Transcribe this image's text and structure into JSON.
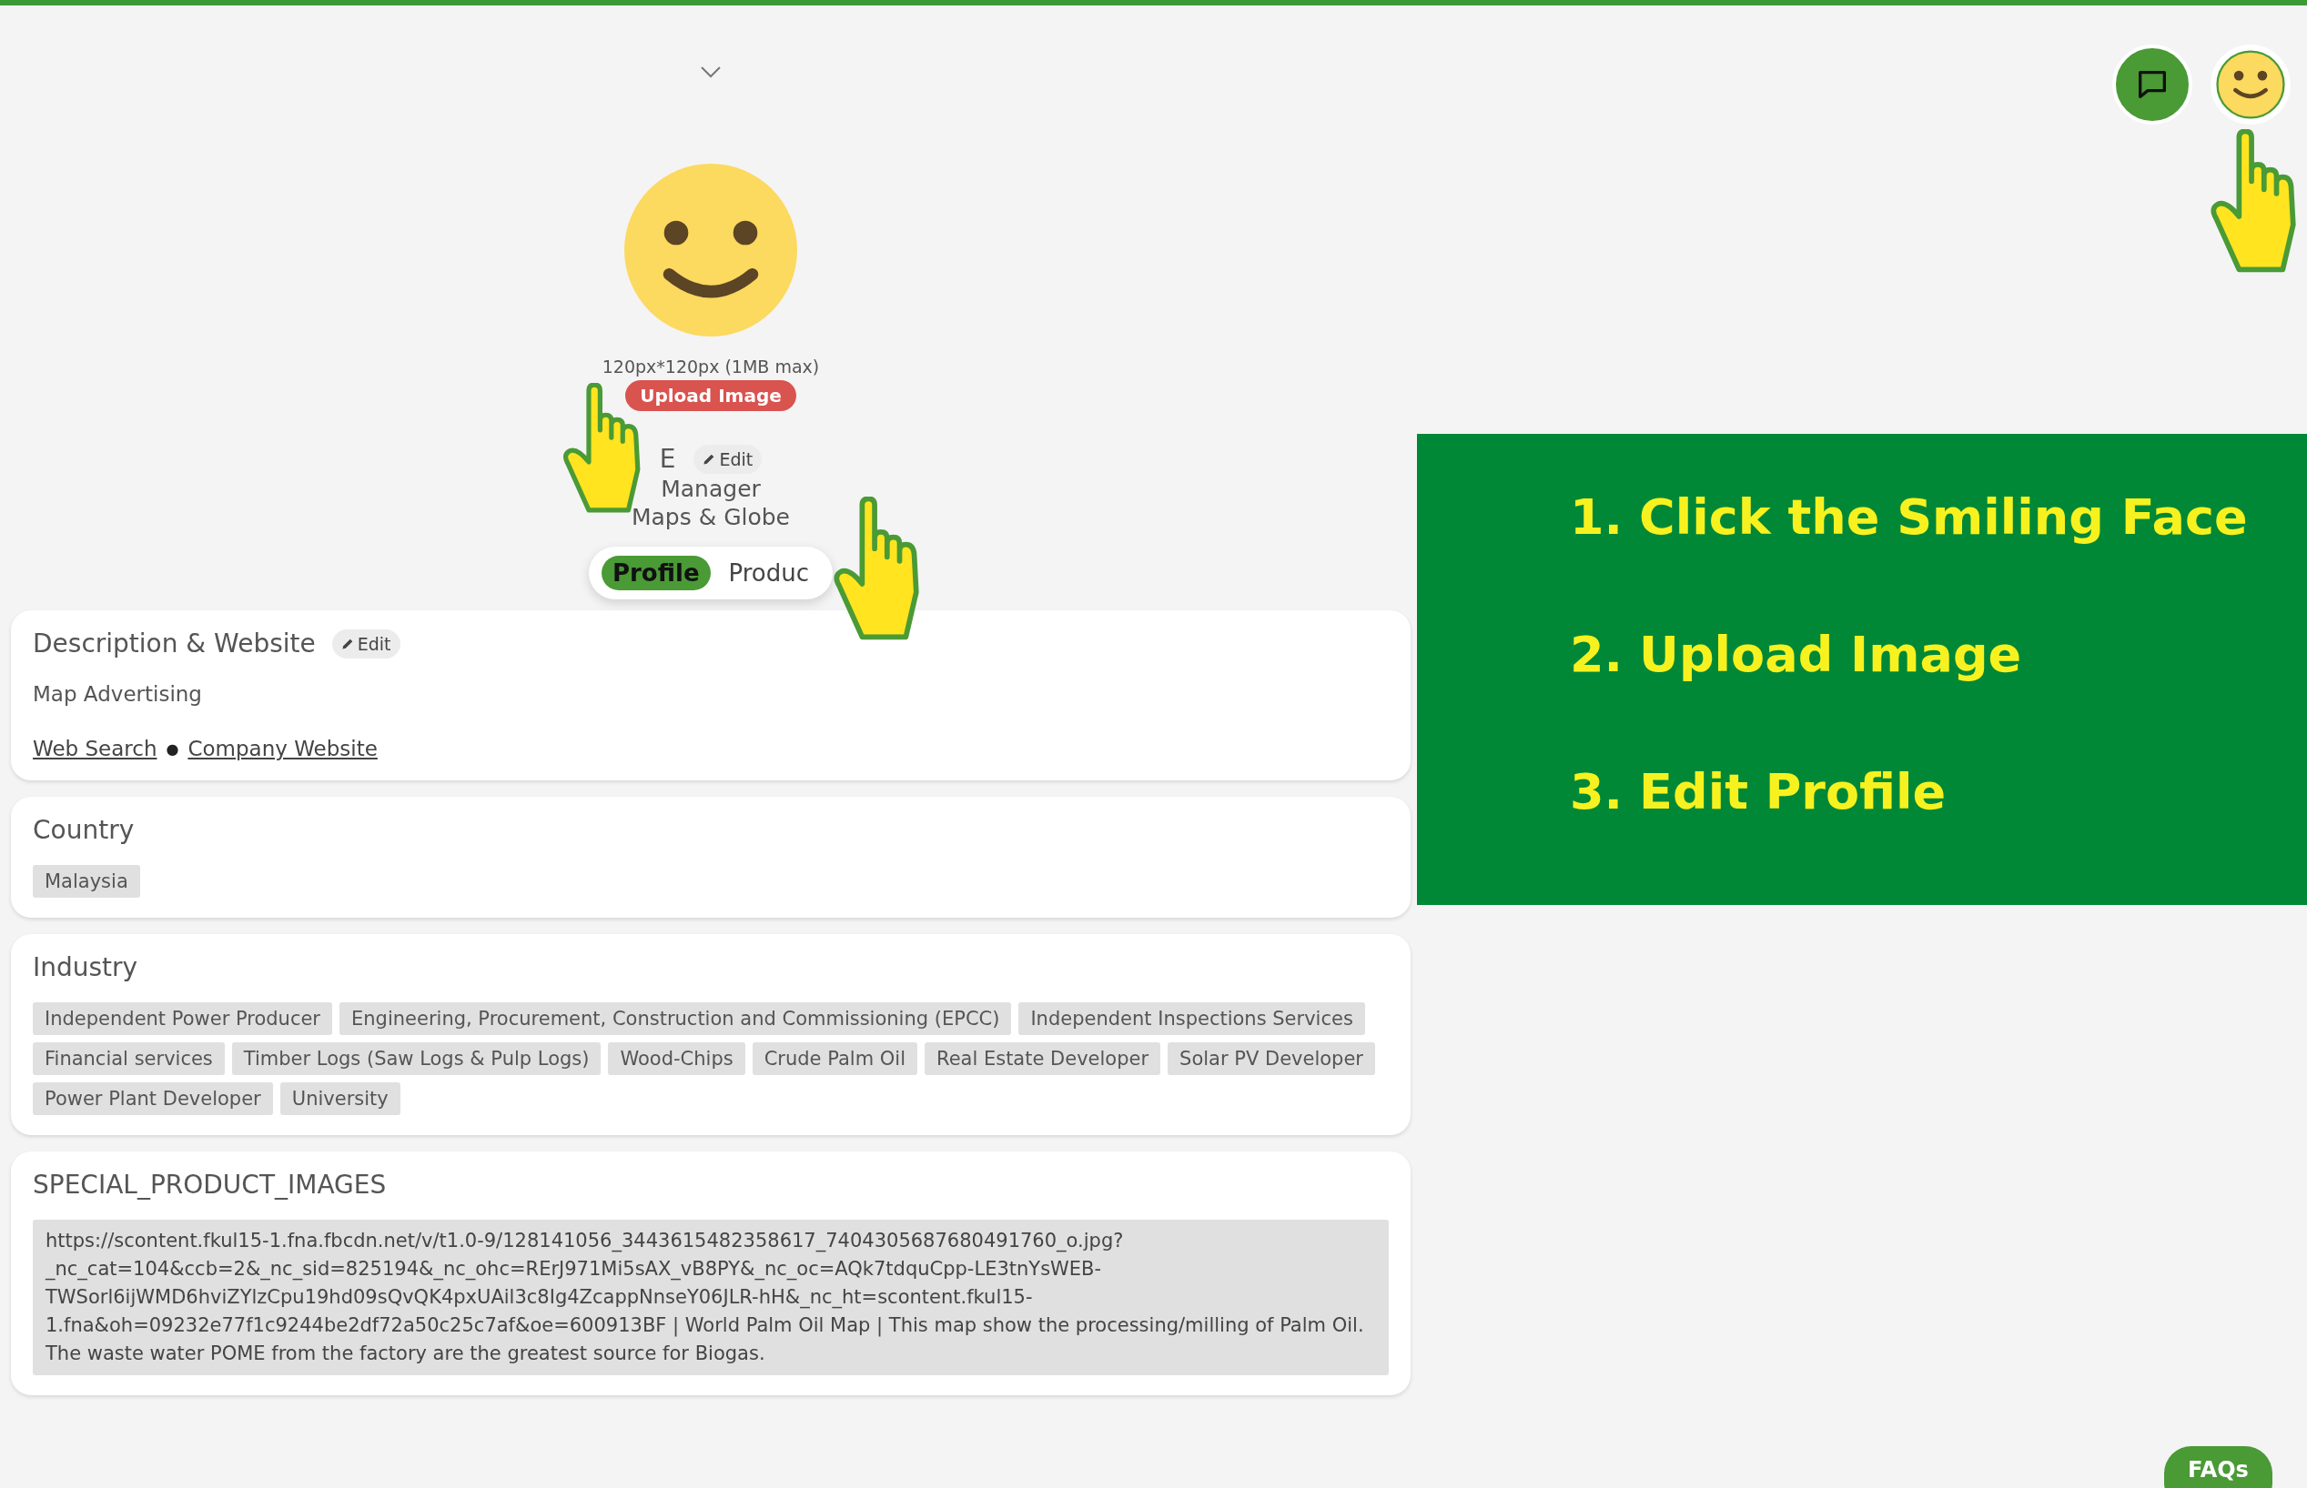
{
  "profile": {
    "image_hint": "120px*120px (1MB max)",
    "upload_button": "Upload Image",
    "name": "E",
    "edit_button": "Edit",
    "role": "Manager",
    "company": "Maps & Globe"
  },
  "tabs": [
    {
      "label": "Profile",
      "selected": true
    },
    {
      "label": "Produc",
      "selected": false
    }
  ],
  "sections": [
    {
      "kind": "description",
      "title": "Description & Website",
      "edit_button": "Edit",
      "text": "Map Advertising",
      "links": [
        "Web Search",
        "Company Website"
      ],
      "separator": "●"
    },
    {
      "kind": "tags",
      "title": "Country",
      "tags": [
        "Malaysia"
      ]
    },
    {
      "kind": "tags",
      "title": "Industry",
      "tags": [
        "Independent Power Producer",
        "Engineering, Procurement, Construction and Commissioning (EPCC)",
        "Independent Inspections Services",
        "Financial services",
        "Timber Logs (Saw Logs & Pulp Logs)",
        "Wood-Chips",
        "Crude Palm Oil",
        "Real Estate Developer",
        "Solar PV Developer",
        "Power Plant Developer",
        "University"
      ]
    },
    {
      "kind": "text_block",
      "title": "SPECIAL_PRODUCT_IMAGES",
      "text": "https://scontent.fkul15-1.fna.fbcdn.net/v/t1.0-9/128141056_3443615482358617_7404305687680491760_o.jpg?_nc_cat=104&ccb=2&_nc_sid=825194&_nc_ohc=RErJ971Mi5sAX_vB8PY&_nc_oc=AQk7tdquCpp-LE3tnYsWEB-TWSorl6ijWMD6hviZYlzCpu19hd09sQvQK4pxUAil3c8Ig4ZcappNnseY06JLR-hH&_nc_ht=scontent.fkul15-1.fna&oh=09232e77f1c9244be2df72a50c25c7af&oe=600913BF | World Palm Oil Map | This map show the processing/milling of Palm Oil. The waste water POME from the factory are the greatest source for Biogas."
    }
  ],
  "instructions": [
    {
      "number": "1.",
      "text": "Click the Smiling Face"
    },
    {
      "number": "2.",
      "text": "Upload Image"
    },
    {
      "number": "3.",
      "text": "Edit Profile"
    }
  ],
  "faq_button": "FAQs"
}
